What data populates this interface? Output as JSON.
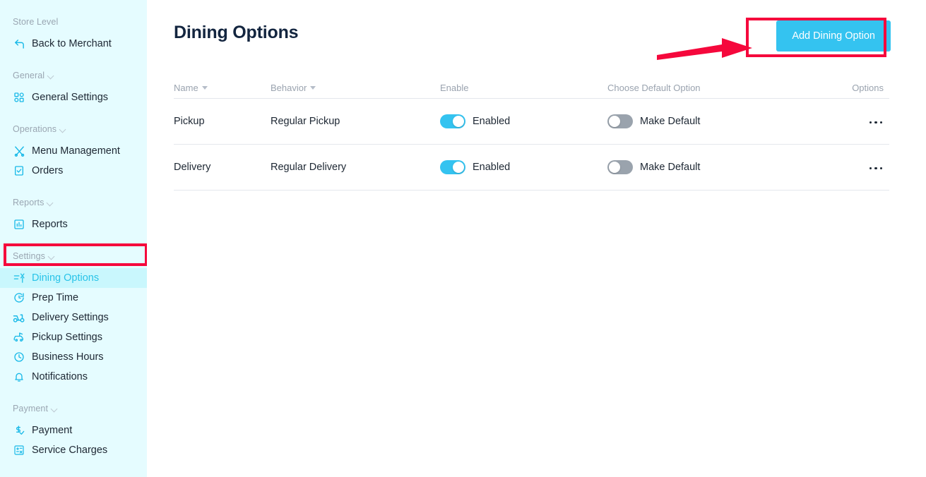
{
  "sidebar": {
    "groups": [
      {
        "label": "Store Level",
        "has_caret": false,
        "items": [
          {
            "label": "Back to Merchant",
            "icon": "back-arrow-icon",
            "active": false
          }
        ]
      },
      {
        "label": "General",
        "has_caret": true,
        "items": [
          {
            "label": "General Settings",
            "icon": "grid-squares-icon",
            "active": false
          }
        ]
      },
      {
        "label": "Operations",
        "has_caret": true,
        "items": [
          {
            "label": "Menu Management",
            "icon": "fork-knife-icon",
            "active": false
          },
          {
            "label": "Orders",
            "icon": "clipboard-check-icon",
            "active": false
          }
        ]
      },
      {
        "label": "Reports",
        "has_caret": true,
        "items": [
          {
            "label": "Reports",
            "icon": "bar-chart-icon",
            "active": false
          }
        ]
      },
      {
        "label": "Settings",
        "has_caret": true,
        "items": [
          {
            "label": "Dining Options",
            "icon": "dining-options-icon",
            "active": true
          },
          {
            "label": "Prep Time",
            "icon": "stopwatch-icon",
            "active": false
          },
          {
            "label": "Delivery Settings",
            "icon": "scooter-icon",
            "active": false
          },
          {
            "label": "Pickup Settings",
            "icon": "car-pickup-icon",
            "active": false
          },
          {
            "label": "Business Hours",
            "icon": "clock-icon",
            "active": false
          },
          {
            "label": "Notifications",
            "icon": "bell-icon",
            "active": false
          }
        ]
      },
      {
        "label": "Payment",
        "has_caret": true,
        "items": [
          {
            "label": "Payment",
            "icon": "dollar-check-icon",
            "active": false
          },
          {
            "label": "Service Charges",
            "icon": "calculator-icon",
            "active": false
          }
        ]
      }
    ]
  },
  "main": {
    "page_title": "Dining Options",
    "add_button_label": "Add Dining Option",
    "table": {
      "columns": [
        {
          "label": "Name",
          "sortable": true
        },
        {
          "label": "Behavior",
          "sortable": true
        },
        {
          "label": "Enable",
          "sortable": false
        },
        {
          "label": "Choose Default Option",
          "sortable": false
        },
        {
          "label": "Options",
          "sortable": false
        }
      ],
      "rows": [
        {
          "name": "Pickup",
          "behavior": "Regular Pickup",
          "enable_label": "Enabled",
          "enable_on": true,
          "default_label": "Make Default",
          "default_on": false,
          "options_icon": "kebab-menu-icon"
        },
        {
          "name": "Delivery",
          "behavior": "Regular Delivery",
          "enable_label": "Enabled",
          "enable_on": true,
          "default_label": "Make Default",
          "default_on": false,
          "options_icon": "kebab-menu-icon"
        }
      ]
    }
  },
  "annotations": {
    "highlight_color": "#f5083c",
    "arrow_name": "red-arrow-annotation",
    "button_highlight_name": "red-box-add-button",
    "sidebar_highlight_name": "red-box-dining-options"
  },
  "colors": {
    "sidebar_bg": "#e5fcff",
    "accent": "#34c3f0",
    "active_item_bg": "#c9f7fd",
    "title": "#13253f"
  }
}
